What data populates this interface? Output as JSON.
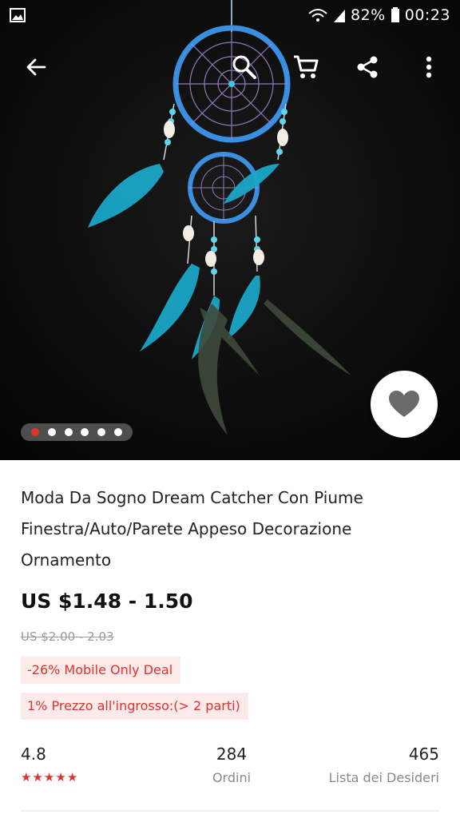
{
  "status_bar": {
    "battery": "82%",
    "time": "00:23"
  },
  "toolbar": {
    "back_icon": "arrow-left-icon",
    "search_icon": "search-icon",
    "cart_icon": "cart-icon",
    "share_icon": "share-icon",
    "more_icon": "more-vert-icon"
  },
  "gallery": {
    "image_count": 6,
    "active_index": 0,
    "favorite_icon": "heart-icon"
  },
  "product": {
    "title": "Moda Da Sogno Dream Catcher Con Piume Finestra/Auto/Parete Appeso Decorazione Ornamento",
    "price": "US $1.48 - 1.50",
    "original_price": "US $2.00 - 2.03",
    "deal_tag": "-26% Mobile Only Deal",
    "wholesale_tag": "1% Prezzo all'ingrosso:(> 2 parti)"
  },
  "stats": {
    "rating": "4.8",
    "rating_stars": 5,
    "orders_count": "284",
    "orders_label": "Ordini",
    "wishlist_count": "465",
    "wishlist_label": "Lista dei Desideri"
  },
  "colors": {
    "accent_red": "#e1332d",
    "tag_bg": "#fdeaea",
    "dreamcatcher_blue": "#3a8fe0",
    "feather_teal": "#1aa6c8"
  }
}
